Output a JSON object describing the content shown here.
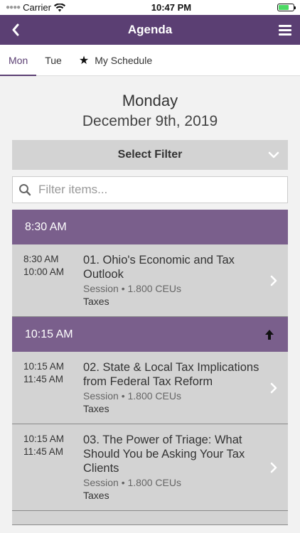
{
  "status": {
    "carrier": "Carrier",
    "time": "10:47 PM"
  },
  "nav": {
    "title": "Agenda"
  },
  "tabs": [
    {
      "label": "Mon"
    },
    {
      "label": "Tue"
    },
    {
      "label": "My Schedule"
    }
  ],
  "day": {
    "name": "Monday",
    "date": "December 9th, 2019"
  },
  "filter": {
    "label": "Select Filter"
  },
  "search": {
    "placeholder": "Filter items..."
  },
  "groups": [
    {
      "time": "8:30 AM",
      "sessions": [
        {
          "start": "8:30 AM",
          "end": "10:00 AM",
          "title": "01. Ohio's Economic and Tax Outlook",
          "meta": "Session • 1.800 CEUs",
          "track": "Taxes"
        }
      ]
    },
    {
      "time": "10:15 AM",
      "sessions": [
        {
          "start": "10:15 AM",
          "end": "11:45 AM",
          "title": "02. State & Local Tax Implications from Federal Tax Reform",
          "meta": "Session • 1.800 CEUs",
          "track": "Taxes"
        },
        {
          "start": "10:15 AM",
          "end": "11:45 AM",
          "title": "03. The Power of Triage: What Should You be Asking Your Tax Clients",
          "meta": "Session • 1.800 CEUs",
          "track": "Taxes"
        }
      ]
    }
  ]
}
